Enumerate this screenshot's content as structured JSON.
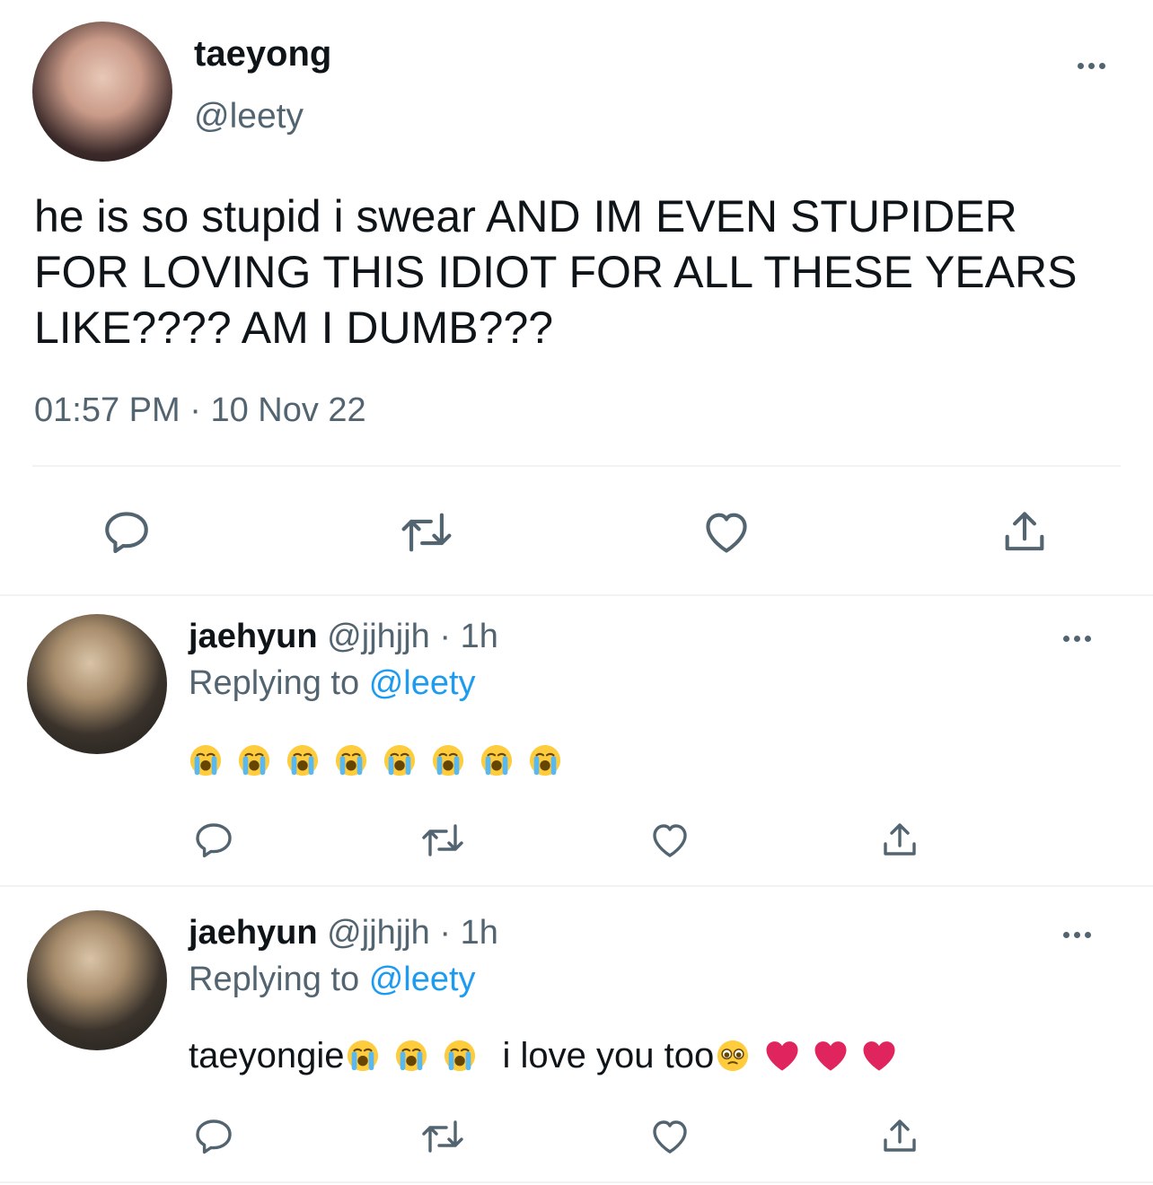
{
  "main_tweet": {
    "display_name": "taeyong",
    "handle": "@leety",
    "text": "he is so stupid i swear AND IM EVEN STUPIDER FOR LOVING THIS IDIOT FOR ALL THESE YEARS LIKE???? AM I DUMB???",
    "time": "01:57 PM",
    "separator": "·",
    "date": "10 Nov 22",
    "actions": [
      "reply-icon",
      "retweet-icon",
      "like-icon",
      "share-icon"
    ]
  },
  "replies": [
    {
      "display_name": "jaehyun",
      "handle": "@jjhjjh",
      "sep": "·",
      "age": "1h",
      "replying_prefix": "Replying to",
      "replying_handle": "@leety",
      "emoji_count": 8,
      "text": ""
    },
    {
      "display_name": "jaehyun",
      "handle": "@jjhjjh",
      "sep": "·",
      "age": "1h",
      "replying_prefix": "Replying to",
      "replying_handle": "@leety",
      "text_word": "taeyongie",
      "text_love": "i love you too"
    }
  ],
  "colors": {
    "link": "#1d9bf0",
    "muted": "#536471",
    "divider": "#eff3f4",
    "heart": "#e0245e"
  }
}
